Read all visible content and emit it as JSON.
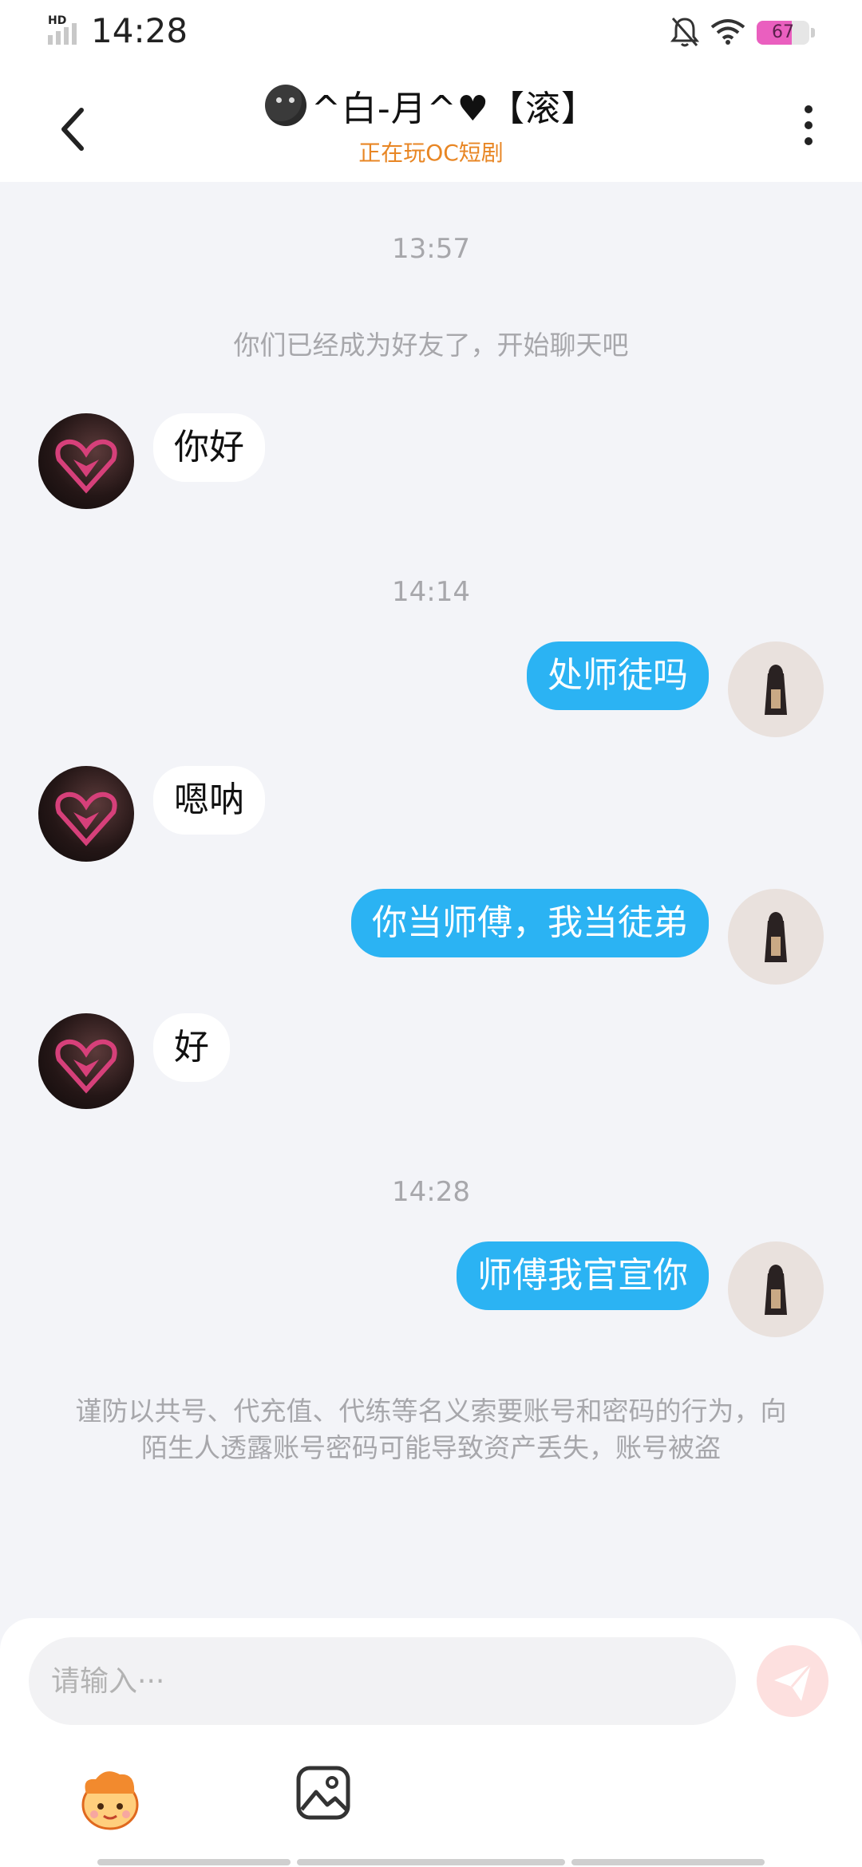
{
  "status_bar": {
    "time": "14:28",
    "network": "HD",
    "battery": "67",
    "battery_fraction": 0.67,
    "icons": [
      "signal-icon",
      "bell-muted-icon",
      "wifi-icon",
      "battery-icon"
    ]
  },
  "header": {
    "title": "^白-月^♥【滚】",
    "subtitle": "正在玩OC短剧",
    "icons": [
      "back-icon",
      "more-icon",
      "title-emoji-icon"
    ]
  },
  "chat": {
    "time1": "13:57",
    "friend_note": "你们已经成为好友了，开始聊天吧",
    "msg1": "你好",
    "time2": "14:14",
    "msg2": "处师徒吗",
    "msg3": "嗯呐",
    "msg4": "你当师傅，我当徒弟",
    "msg5": "好",
    "time3": "14:28",
    "msg6": "师傅我官宣你",
    "warning": "谨防以共号、代充值、代练等名义索要账号和密码的行为，向陌生人透露账号密码可能导致资产丢失，账号被盗"
  },
  "composer": {
    "placeholder": "请输入···",
    "icons": [
      "send-icon",
      "emoji-icon",
      "image-icon"
    ]
  },
  "colors": {
    "accent_blue": "#2bb3f3",
    "subtitle_orange": "#e88624",
    "background": "#f3f4f8"
  }
}
